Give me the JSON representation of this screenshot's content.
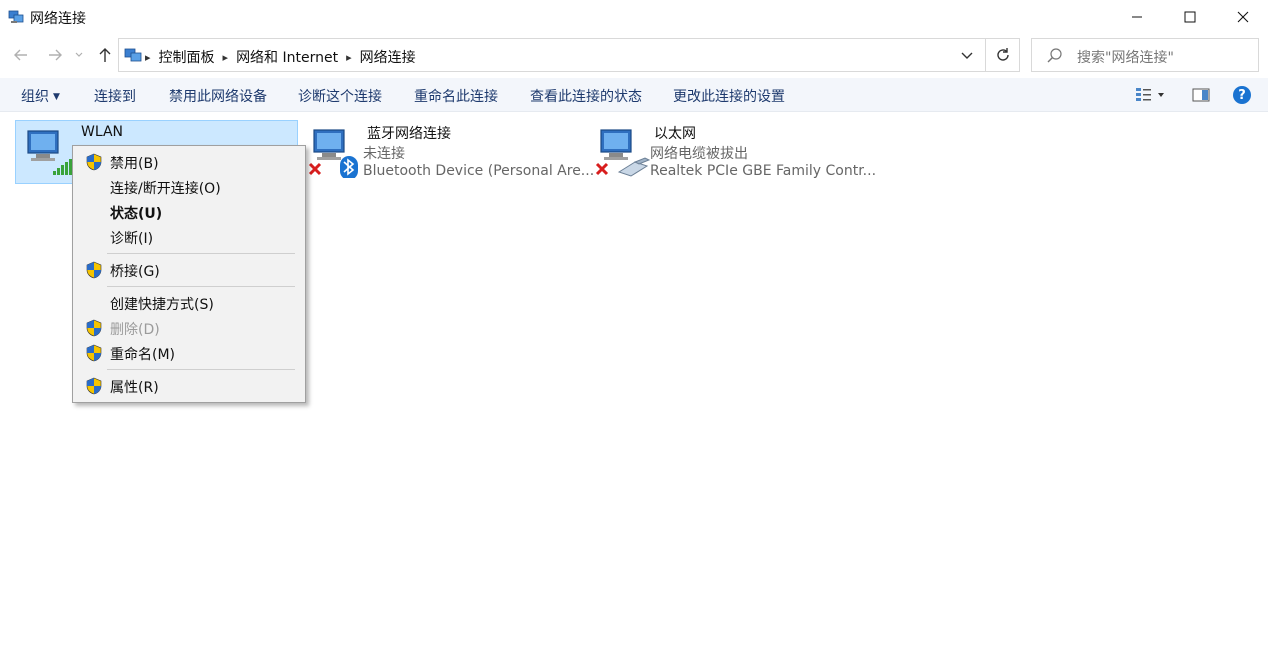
{
  "window": {
    "title": "网络连接",
    "controls": {
      "minimize": "minimize",
      "maximize": "maximize",
      "close": "close"
    }
  },
  "nav": {
    "back_icon": "arrow-left-icon",
    "forward_icon": "arrow-right-icon",
    "up_icon": "arrow-up-icon",
    "breadcrumbs": [
      "控制面板",
      "网络和 Internet",
      "网络连接"
    ],
    "search_placeholder": "搜索\"网络连接\""
  },
  "commands": {
    "organize": "组织",
    "connect_to": "连接到",
    "disable_device": "禁用此网络设备",
    "diagnose": "诊断这个连接",
    "rename": "重命名此连接",
    "view_status": "查看此连接的状态",
    "change_settings": "更改此连接的设置",
    "help": "?"
  },
  "connections": [
    {
      "name": "WLAN",
      "status": "",
      "device": "",
      "selected": true
    },
    {
      "name": "蓝牙网络连接",
      "status": "未连接",
      "device": "Bluetooth Device (Personal Are..."
    },
    {
      "name": "以太网",
      "status": "网络电缆被拔出",
      "device": "Realtek PCIe GBE Family Contr..."
    }
  ],
  "context_menu": {
    "items": [
      {
        "label": "禁用(B)",
        "shield": true
      },
      {
        "label": "连接/断开连接(O)",
        "shield": false
      },
      {
        "label": "状态(U)",
        "shield": false,
        "bold": true
      },
      {
        "label": "诊断(I)",
        "shield": false
      },
      {
        "label": "桥接(G)",
        "shield": true
      },
      {
        "label": "创建快捷方式(S)",
        "shield": false
      },
      {
        "label": "删除(D)",
        "shield": true,
        "disabled": true
      },
      {
        "label": "重命名(M)",
        "shield": true
      },
      {
        "label": "属性(R)",
        "shield": true
      }
    ]
  },
  "colors": {
    "accent": "#1a73d1",
    "command_text": "#1e3a6e",
    "selection_bg": "#cce8ff",
    "selection_border": "#99d1ff",
    "error_red": "#d81e1e"
  }
}
